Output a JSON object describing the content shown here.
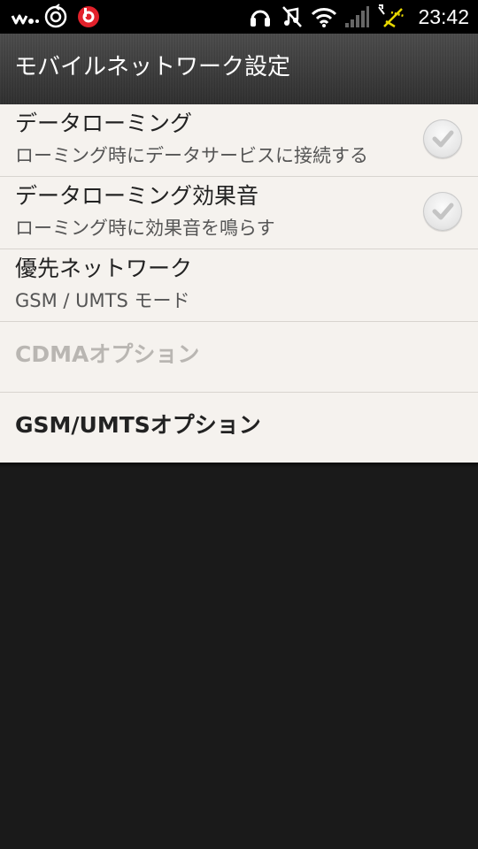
{
  "status_bar": {
    "time": "23:42",
    "icons": [
      "walkman-icon",
      "sync-icon",
      "beats-icon",
      "headset-icon",
      "mute-icon",
      "wifi-icon",
      "signal-icon",
      "usb-debug-icon"
    ]
  },
  "header": {
    "title": "モバイルネットワーク設定"
  },
  "settings": {
    "items": [
      {
        "title": "データローミング",
        "summary": "ローミング時にデータサービスに接続する",
        "checked": false
      },
      {
        "title": "データローミング効果音",
        "summary": "ローミング時に効果音を鳴らす",
        "checked": false
      },
      {
        "title": "優先ネットワーク",
        "summary": "GSM / UMTS モード"
      },
      {
        "title": "CDMAオプション",
        "enabled": false
      },
      {
        "title": "GSM/UMTSオプション",
        "enabled": true
      }
    ]
  },
  "colors": {
    "list_background": "#f5f2ee",
    "screen_background": "#1a1a1a",
    "disabled_text": "#b9b6b2"
  }
}
